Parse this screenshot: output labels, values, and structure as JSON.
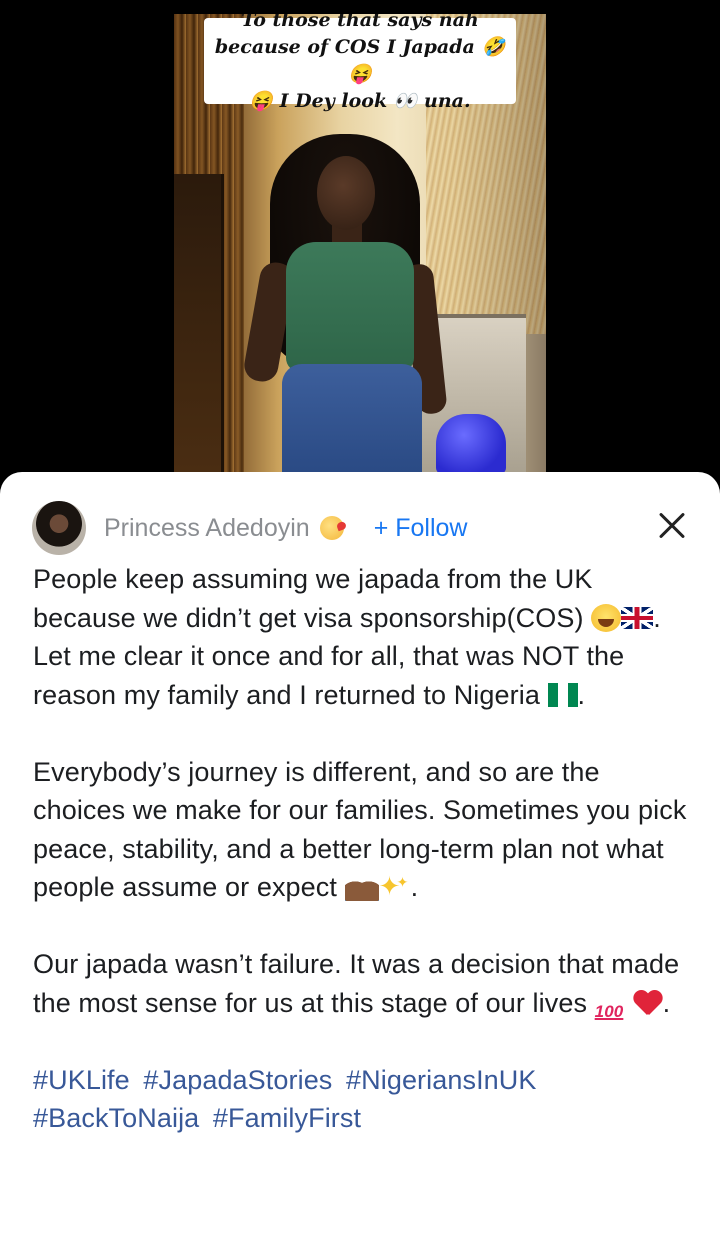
{
  "video": {
    "caption_line1": "To those that says nah",
    "caption_line2": "because of COS I Japada 🤣😝",
    "caption_line3": "😝 I Dey look 👀 una."
  },
  "post": {
    "author": "Princess Adedoyin",
    "author_emoji": "kissing-heart-emoji",
    "follow_label": "+ Follow",
    "paragraph1_a": "People keep assuming we japada from the UK because we didn’t get visa sponsorship(COS) ",
    "paragraph1_b": ". Let me clear it once and for all, that was NOT the reason my family and I returned to Nigeria ",
    "paragraph1_c": ".",
    "paragraph2_a": "Everybody’s journey is different, and so are the choices we make for our families. Sometimes you pick peace, stability, and a better long-term plan not what people assume or expect ",
    "paragraph2_b": ".",
    "paragraph3_a": "Our japada wasn’t failure. It was a decision that made the most sense for us at this stage of our lives ",
    "paragraph3_b": ".",
    "emoji_100": "100",
    "hashtags": [
      "#UKLife",
      "#JapadaStories",
      "#NigeriansInUK",
      "#BackToNaija",
      "#FamilyFirst"
    ]
  },
  "colors": {
    "follow": "#1877f2",
    "hashtag": "#385898",
    "text": "#1c1e21",
    "author": "#8a8d91"
  }
}
